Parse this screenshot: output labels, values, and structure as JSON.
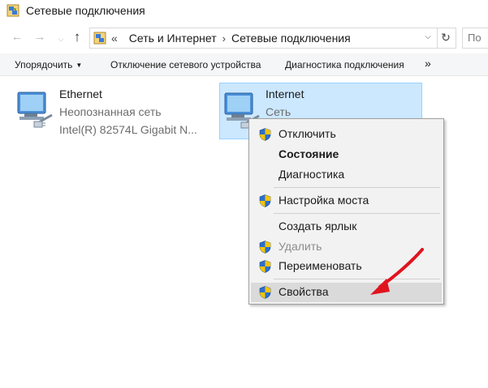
{
  "window": {
    "title": "Сетевые подключения"
  },
  "nav": {
    "back": "←",
    "forward": "→",
    "up": "↑"
  },
  "address": {
    "prefix": "«",
    "crumbs": [
      "Сеть и Интернет",
      "Сетевые подключения"
    ],
    "separator": "›",
    "dropdown": "⌵",
    "refresh": "↻"
  },
  "search": {
    "placeholder": "По"
  },
  "toolbar": {
    "organize": "Упорядочить",
    "organize_caret": "▼",
    "disable_device": "Отключение сетевого устройства",
    "diagnose": "Диагностика подключения",
    "more": "»"
  },
  "connections": [
    {
      "name": "Ethernet",
      "status": "Неопознанная сеть",
      "adapter": "Intel(R) 82574L Gigabit N..."
    },
    {
      "name": "Internet",
      "status": "Сеть",
      "adapter": ""
    }
  ],
  "context_menu": {
    "items": [
      {
        "label": "Отключить",
        "shield": true
      },
      {
        "label": "Состояние",
        "shield": false,
        "bold": true
      },
      {
        "label": "Диагностика",
        "shield": false
      },
      {
        "label": "Настройка моста",
        "shield": true
      },
      {
        "label": "Создать ярлык",
        "shield": false
      },
      {
        "label": "Удалить",
        "shield": true,
        "disabled": true
      },
      {
        "label": "Переименовать",
        "shield": true
      },
      {
        "label": "Свойства",
        "shield": true,
        "hovered": true
      }
    ]
  },
  "colors": {
    "selection": "#cce8ff",
    "arrow": "#e0141e",
    "menu_bg": "#f2f2f2"
  }
}
